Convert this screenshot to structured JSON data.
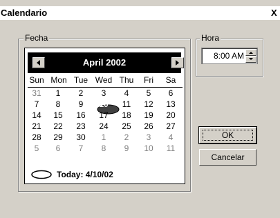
{
  "window": {
    "title": "Calendario",
    "close_label": "X"
  },
  "fecha": {
    "group_label": "Fecha",
    "month_label": "April 2002",
    "weekdays": [
      "Sun",
      "Mon",
      "Tue",
      "Wed",
      "Thu",
      "Fri",
      "Sa"
    ],
    "rows": [
      [
        "31",
        "1",
        "2",
        "3",
        "4",
        "5",
        "6"
      ],
      [
        "7",
        "8",
        "9",
        "10",
        "11",
        "12",
        "13"
      ],
      [
        "14",
        "15",
        "16",
        "17",
        "18",
        "19",
        "20"
      ],
      [
        "21",
        "22",
        "23",
        "24",
        "25",
        "26",
        "27"
      ],
      [
        "28",
        "29",
        "30",
        "1",
        "2",
        "3",
        "4"
      ],
      [
        "5",
        "6",
        "7",
        "8",
        "9",
        "10",
        "11"
      ]
    ],
    "selected_day": "10",
    "today_label": "Today: 4/10/02"
  },
  "hora": {
    "group_label": "Hora",
    "value": "8:00 AM"
  },
  "buttons": {
    "ok": "OK",
    "cancel": "Cancelar"
  },
  "colors": {
    "face": "#d4d0c8",
    "header": "#000000",
    "grey_day": "#808080"
  }
}
